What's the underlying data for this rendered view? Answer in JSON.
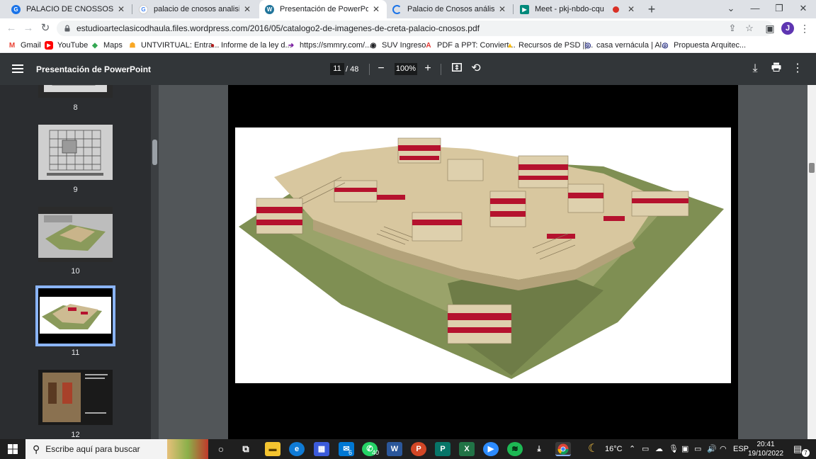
{
  "tabs": [
    {
      "title": "PALACIO DE CNOSSOS - GRUPO",
      "favicon": "classroom-icon"
    },
    {
      "title": "palacio de cnosos analisis - Búsq",
      "favicon": "google-icon"
    },
    {
      "title": "Presentación de PowerPoint",
      "favicon": "wordpress-icon",
      "active": true
    },
    {
      "title": "Palacio de Cnosos análisis arquit",
      "favicon": "loading-icon"
    },
    {
      "title": "Meet - pkj-nbdo-cqu",
      "favicon": "meet-icon"
    }
  ],
  "address": {
    "url": "estudioarteclasicodhaula.files.wordpress.com/2016/05/catalogo2-de-imagenes-de-creta-palacio-cnosos.pdf"
  },
  "profile": {
    "initial": "J"
  },
  "bookmarks": [
    {
      "label": "Gmail",
      "icon": "gmail-icon"
    },
    {
      "label": "YouTube",
      "icon": "youtube-icon"
    },
    {
      "label": "Maps",
      "icon": "maps-icon"
    },
    {
      "label": "UNTVIRTUAL: Entra...",
      "icon": "moodle-icon"
    },
    {
      "label": "Informe de la ley d...",
      "icon": "bookmark-icon"
    },
    {
      "label": "https://smmry.com/...",
      "icon": "arrow-icon"
    },
    {
      "label": "SUV Ingreso",
      "icon": "globe-icon"
    },
    {
      "label": "PDF a PPT: Conviert...",
      "icon": "pdf-icon"
    },
    {
      "label": "Recursos de PSD ||...",
      "icon": "drive-icon"
    },
    {
      "label": "casa vernácula | Al...",
      "icon": "circle-icon"
    },
    {
      "label": "Propuesta Arquitec...",
      "icon": "circle-icon"
    }
  ],
  "viewer": {
    "title": "Presentación de PowerPoint",
    "current_page": "11",
    "page_separator": "/",
    "total_pages": "48",
    "zoom": "100%"
  },
  "thumbnails": [
    {
      "page": "8"
    },
    {
      "page": "9"
    },
    {
      "page": "10"
    },
    {
      "page": "11",
      "selected": true
    },
    {
      "page": "12"
    }
  ],
  "taskbar": {
    "search_placeholder": "Escribe aquí para buscar",
    "weather": "16°C",
    "language": "ESP",
    "time": "20:41",
    "date": "19/10/2022",
    "mail_badge": "6",
    "whatsapp_badge": "40",
    "notifications_badge": "7"
  }
}
